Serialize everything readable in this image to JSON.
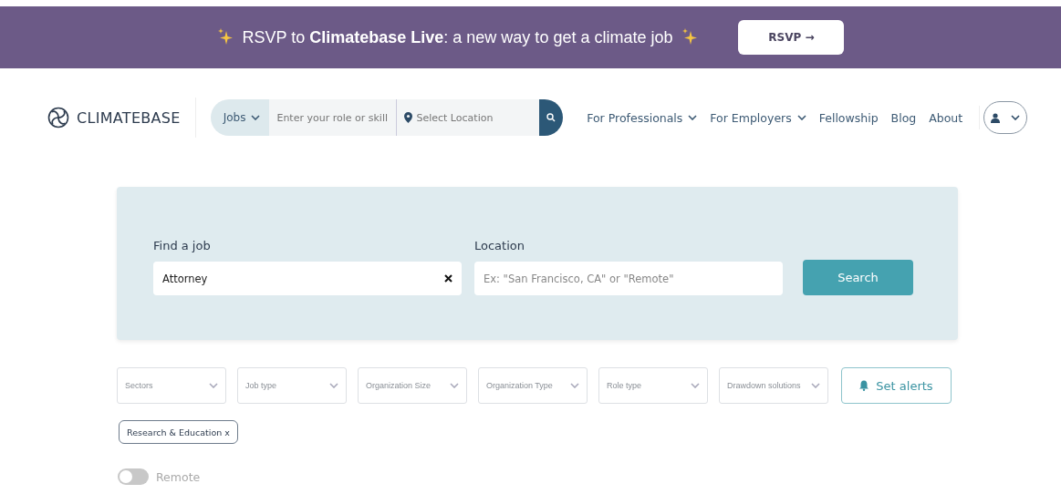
{
  "banner": {
    "text": "RSVP to **Climatebase Live**: a new way to get a climate job",
    "button": "RSVP →"
  },
  "header": {
    "logo": "CLIMATEBASE",
    "search": {
      "scope": "Jobs",
      "role_placeholder": "Enter your role or skill",
      "location_placeholder": "Select Location"
    },
    "nav": [
      {
        "label": "For Professionals",
        "dropdown": true
      },
      {
        "label": "For Employers",
        "dropdown": true
      },
      {
        "label": "Fellowship",
        "dropdown": false
      },
      {
        "label": "Blog",
        "dropdown": false
      },
      {
        "label": "About",
        "dropdown": false
      }
    ]
  },
  "search_card": {
    "job_label": "Find a job",
    "job_value": "Attorney",
    "location_label": "Location",
    "location_placeholder": "Ex: \"San Francisco, CA\" or \"Remote\"",
    "button": "Search"
  },
  "filters": [
    "Sectors",
    "Job type",
    "Organization Size",
    "Organization Type",
    "Role type",
    "Drawdown solutions"
  ],
  "alerts_button": "Set alerts",
  "chips": [
    "Research & Education x"
  ],
  "remote_toggle": {
    "label": "Remote",
    "on": false
  }
}
